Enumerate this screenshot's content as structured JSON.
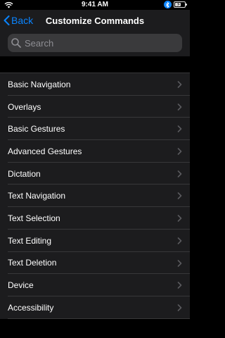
{
  "status_bar": {
    "time": "9:41 AM",
    "icons": [
      "wifi-icon",
      "bluetooth-icon",
      "battery-charging-icon"
    ]
  },
  "nav": {
    "back_label": "Back",
    "title": "Customize Commands"
  },
  "search": {
    "placeholder": "Search"
  },
  "commands": [
    {
      "label": "Basic Navigation"
    },
    {
      "label": "Overlays"
    },
    {
      "label": "Basic Gestures"
    },
    {
      "label": "Advanced Gestures"
    },
    {
      "label": "Dictation"
    },
    {
      "label": "Text Navigation"
    },
    {
      "label": "Text Selection"
    },
    {
      "label": "Text Editing"
    },
    {
      "label": "Text Deletion"
    },
    {
      "label": "Device"
    },
    {
      "label": "Accessibility"
    }
  ],
  "colors": {
    "accent": "#0a84ff",
    "background": "#000000",
    "surface": "#1c1c1e",
    "field": "#3a3a3c",
    "separator": "#38383a"
  }
}
